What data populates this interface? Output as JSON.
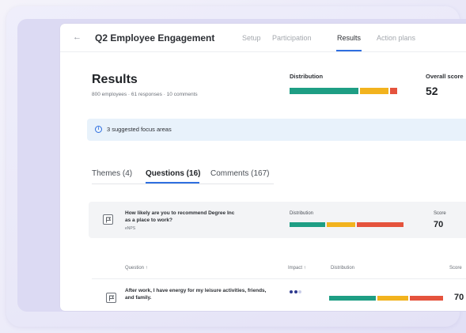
{
  "nav": {
    "title": "Q2 Employee Engagement",
    "tabs": [
      {
        "label": "Setup"
      },
      {
        "label": "Participation"
      },
      {
        "label": "Results",
        "active": true
      },
      {
        "label": "Action plans"
      }
    ]
  },
  "results": {
    "title": "Results",
    "subtitle": "800 employees · 61 responses · 10 comments",
    "distribution_label": "Distribution",
    "distribution": [
      {
        "color": "#1e9e84",
        "fraction": 0.62
      },
      {
        "color": "#f2b31e",
        "fraction": 0.26
      },
      {
        "color": "#e5533d",
        "fraction": 0.06
      }
    ],
    "overall_label": "Overall score",
    "overall_value": "52"
  },
  "focus": {
    "icon": "info-icon",
    "text": "3 suggested focus areas"
  },
  "subtabs": [
    {
      "label": "Themes (4)"
    },
    {
      "label": "Questions (16)",
      "active": true
    },
    {
      "label": "Comments (167)"
    }
  ],
  "enps": {
    "question": "How likely are you to recommend Degree Inc as a place to work?",
    "tag": "eNPS",
    "distribution_label": "Distribution",
    "distribution": [
      {
        "color": "#1e9e84",
        "fraction": 0.32
      },
      {
        "color": "#f2b31e",
        "fraction": 0.26
      },
      {
        "color": "#e5533d",
        "fraction": 0.42
      }
    ],
    "score_label": "Score",
    "score_value": "70"
  },
  "table": {
    "headers": {
      "question": "Question ↑",
      "impact": "Impact ↑",
      "distribution": "Distribution",
      "score": "Score"
    },
    "rows": [
      {
        "question": "After work, I have energy for my leisure activities, friends, and family.",
        "impact_level": 2,
        "impact_max": 3,
        "distribution": [
          {
            "color": "#1e9e84",
            "fraction": 0.42
          },
          {
            "color": "#f2b31e",
            "fraction": 0.28
          },
          {
            "color": "#e5533d",
            "fraction": 0.3
          }
        ],
        "score": "70"
      }
    ]
  },
  "colors": {
    "accent": "#2f6fe0",
    "favorable": "#1e9e84",
    "neutral": "#f2b31e",
    "unfavorable": "#e5533d"
  }
}
